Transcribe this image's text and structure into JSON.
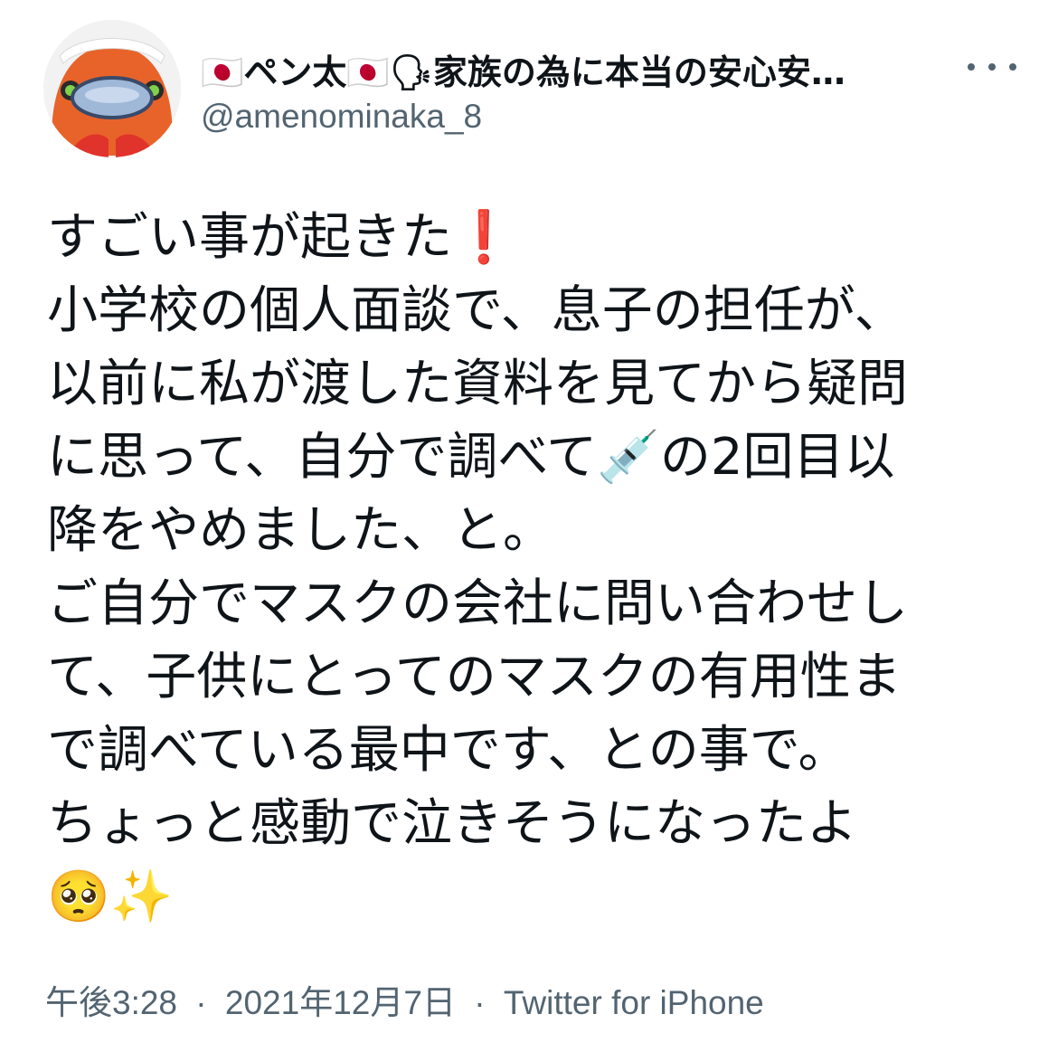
{
  "author": {
    "display_name": "🇯🇵ペン太🇯🇵🗣家族の為に本当の安心安…",
    "handle": "@amenominaka_8",
    "avatar_icon": "penguin-mascot-avatar"
  },
  "tweet": {
    "lines": [
      "すごい事が起きた❗️",
      "小学校の個人面談で、息子の担任が、",
      "以前に私が渡した資料を見てから疑問",
      "に思って、自分で調べて💉の2回目以",
      "降をやめました、と。",
      "ご自分でマスクの会社に問い合わせし",
      "て、子供にとってのマスクの有用性ま",
      "で調べている最中です、との事で。",
      "ちょっと感動で泣きそうになったよ",
      "🥺✨"
    ]
  },
  "meta": {
    "time": "午後3:28",
    "separator": "·",
    "date": "2021年12月7日",
    "source": "Twitter for iPhone"
  },
  "colors": {
    "text": "#0f1419",
    "secondary": "#536471",
    "background": "#ffffff"
  }
}
